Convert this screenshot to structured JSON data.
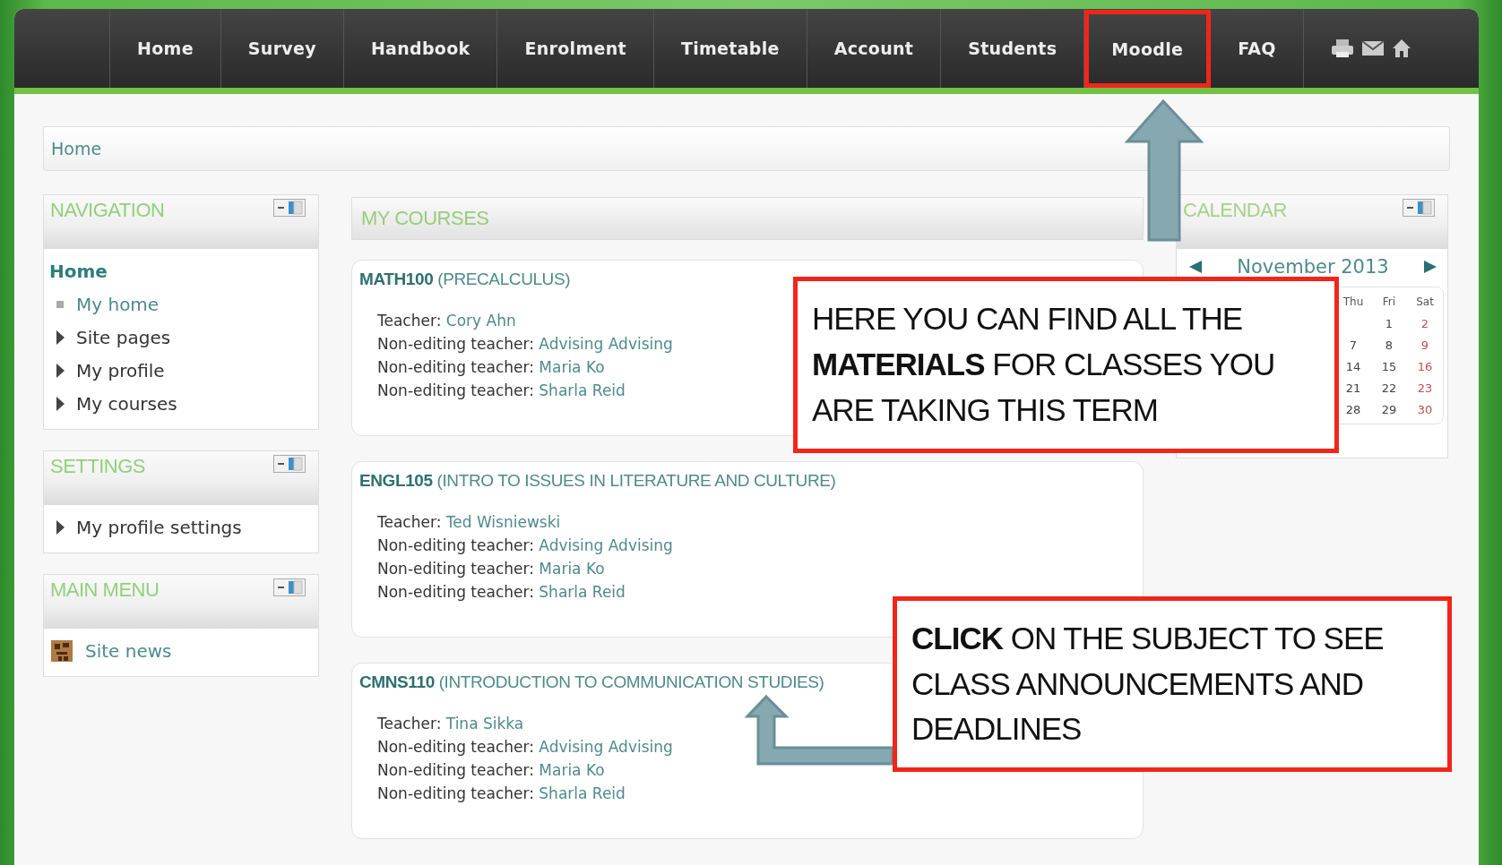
{
  "nav": {
    "items": [
      {
        "label": "Home",
        "highlighted": false
      },
      {
        "label": "Survey",
        "highlighted": false
      },
      {
        "label": "Handbook",
        "highlighted": false
      },
      {
        "label": "Enrolment",
        "highlighted": false
      },
      {
        "label": "Timetable",
        "highlighted": false
      },
      {
        "label": "Account",
        "highlighted": false
      },
      {
        "label": "Students",
        "highlighted": false
      },
      {
        "label": "Moodle",
        "highlighted": true
      },
      {
        "label": "FAQ",
        "highlighted": false
      }
    ]
  },
  "breadcrumb": "Home",
  "blocks": [
    {
      "title": "NAVIGATION",
      "items": [
        {
          "label": "Home",
          "kind": "current"
        },
        {
          "label": "My home",
          "kind": "leaf"
        },
        {
          "label": "Site pages",
          "kind": "branch"
        },
        {
          "label": "My profile",
          "kind": "branch"
        },
        {
          "label": "My courses",
          "kind": "branch"
        }
      ]
    },
    {
      "title": "SETTINGS",
      "items": [
        {
          "label": "My profile settings",
          "kind": "branch"
        }
      ]
    },
    {
      "title": "MAIN MENU",
      "items": [
        {
          "label": "Site news",
          "kind": "news"
        }
      ]
    }
  ],
  "my_courses": {
    "title": "MY COURSES",
    "courses": [
      {
        "code": "MATH100",
        "name": "(PRECALCULUS)",
        "teachers": [
          {
            "role": "Teacher:",
            "name": "Cory Ahn"
          },
          {
            "role": "Non-editing teacher:",
            "name": "Advising Advising"
          },
          {
            "role": "Non-editing teacher:",
            "name": "Maria Ko"
          },
          {
            "role": "Non-editing teacher:",
            "name": "Sharla Reid"
          }
        ]
      },
      {
        "code": "ENGL105",
        "name": "(INTRO TO ISSUES IN LITERATURE AND CULTURE)",
        "teachers": [
          {
            "role": "Teacher:",
            "name": "Ted Wisniewski"
          },
          {
            "role": "Non-editing teacher:",
            "name": "Advising Advising"
          },
          {
            "role": "Non-editing teacher:",
            "name": "Maria Ko"
          },
          {
            "role": "Non-editing teacher:",
            "name": "Sharla Reid"
          }
        ]
      },
      {
        "code": "CMNS110",
        "name": "(INTRODUCTION TO COMMUNICATION STUDIES)",
        "teachers": [
          {
            "role": "Teacher:",
            "name": "Tina Sikka"
          },
          {
            "role": "Non-editing teacher:",
            "name": "Advising Advising"
          },
          {
            "role": "Non-editing teacher:",
            "name": "Maria Ko"
          },
          {
            "role": "Non-editing teacher:",
            "name": "Sharla Reid"
          }
        ]
      }
    ]
  },
  "calendar": {
    "title": "CALENDAR",
    "month": "November 2013",
    "day_headers": [
      "Thu",
      "Fri",
      "Sat"
    ],
    "weeks": [
      [
        {
          "day": "1",
          "weekend": false
        },
        {
          "day": "2",
          "weekend": true
        }
      ],
      [
        {
          "day": "7",
          "weekend": false
        },
        {
          "day": "8",
          "weekend": false
        },
        {
          "day": "9",
          "weekend": true
        }
      ],
      [
        {
          "day": "14",
          "weekend": false
        },
        {
          "day": "15",
          "weekend": false
        },
        {
          "day": "16",
          "weekend": true
        }
      ],
      [
        {
          "day": "21",
          "weekend": false
        },
        {
          "day": "22",
          "weekend": false
        },
        {
          "day": "23",
          "weekend": true
        }
      ],
      [
        {
          "day": "28",
          "weekend": false
        },
        {
          "day": "29",
          "weekend": false
        },
        {
          "day": "30",
          "weekend": true
        }
      ]
    ]
  },
  "annotations": [
    {
      "text": "HERE YOU CAN FIND ALL THE **MATERIALS** FOR CLASSES YOU ARE TAKING THIS TERM",
      "kind": "up"
    },
    {
      "text": "**CLICK** ON THE SUBJECT TO SEE CLASS ANNOUNCEMENTS AND DEADLINES",
      "kind": "elbow"
    }
  ]
}
